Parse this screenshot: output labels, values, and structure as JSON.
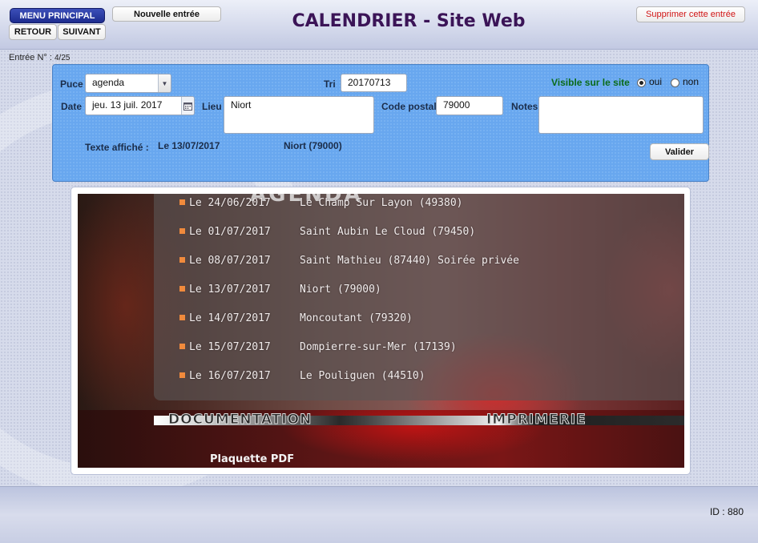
{
  "header": {
    "menu_principal": "MENU PRINCIPAL",
    "retour": "RETOUR",
    "suivant": "SUIVANT",
    "nouvelle_entree": "Nouvelle entrée",
    "title": "CALENDRIER - Site Web",
    "supprimer": "Supprimer cette entrée"
  },
  "entry": {
    "label": "Entrée N° :",
    "number": "4/25"
  },
  "form": {
    "puce_label": "Puce",
    "puce_value": "agenda",
    "tri_label": "Tri",
    "tri_value": "20170713",
    "visible_label": "Visible sur le site",
    "visible_oui": "oui",
    "visible_non": "non",
    "visible_selected": "oui",
    "date_label": "Date",
    "date_value": "jeu. 13 juil. 2017",
    "lieu_label": "Lieu",
    "lieu_value": "Niort",
    "code_postal_label": "Code postal",
    "code_postal_value": "79000",
    "notes_label": "Notes",
    "notes_value": "",
    "texte_affiche_label": "Texte affiché :",
    "texte_affiche_date": "Le 13/07/2017",
    "texte_affiche_lieu": "Niort (79000)",
    "valider": "Valider"
  },
  "preview": {
    "heading": "AGENDA",
    "items": [
      {
        "date": "Le 24/06/2017",
        "place": "Le Champ Sur Layon (49380)"
      },
      {
        "date": "Le 01/07/2017",
        "place": "Saint Aubin Le Cloud (79450)"
      },
      {
        "date": "Le 08/07/2017",
        "place": "Saint Mathieu (87440) Soirée privée"
      },
      {
        "date": "Le 13/07/2017",
        "place": "Niort (79000)"
      },
      {
        "date": "Le 14/07/2017",
        "place": "Moncoutant (79320)"
      },
      {
        "date": "Le 15/07/2017",
        "place": "Dompierre-sur-Mer (17139)"
      },
      {
        "date": "Le 16/07/2017",
        "place": "Le Pouliguen (44510)"
      }
    ],
    "menu_documentation": "DOCUMENTATION",
    "menu_imprimerie": "IMPRIMERIE",
    "plaquette": "Plaquette PDF"
  },
  "footer": {
    "id_label": "ID : 880"
  },
  "colors": {
    "title": "#3b1457",
    "menu_button": "#1d2c8f",
    "form_panel": "#68a7ef",
    "delete_text": "#d01414",
    "visible_label": "#0b6b1a",
    "bullet": "#f08a3c"
  }
}
